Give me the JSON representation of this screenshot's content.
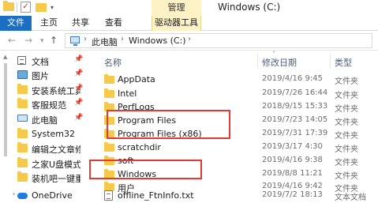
{
  "window": {
    "title": "Windows (C:)",
    "context_tab_group": "管理"
  },
  "quick_access": {
    "dropdown_glyph": "▾"
  },
  "ribbon": {
    "tabs": [
      {
        "label": "文件"
      },
      {
        "label": "主页"
      },
      {
        "label": "共享"
      },
      {
        "label": "查看"
      },
      {
        "label": "驱动器工具"
      }
    ]
  },
  "address": {
    "crumbs": [
      "此电脑",
      "Windows (C:)"
    ]
  },
  "nav_pane": {
    "items": [
      {
        "label": "文档",
        "icon": "document-icon",
        "pinned": true
      },
      {
        "label": "图片",
        "icon": "picture-icon",
        "pinned": true
      },
      {
        "label": "安装系统工具",
        "icon": "folder-icon",
        "pinned": true
      },
      {
        "label": "客服规范",
        "icon": "folder-icon",
        "pinned": true
      },
      {
        "label": "此电脑",
        "icon": "computer-icon",
        "pinned": true
      },
      {
        "label": "System32",
        "icon": "folder-icon",
        "pinned": false
      },
      {
        "label": "编辑之文章修改",
        "icon": "folder-icon",
        "pinned": false
      },
      {
        "label": "之家U盘模式装系",
        "icon": "folder-icon",
        "pinned": false
      },
      {
        "label": "装机吧一键重装",
        "icon": "folder-icon",
        "pinned": false
      },
      {
        "label": "OneDrive",
        "icon": "onedrive-cloud-icon",
        "pinned": false
      }
    ],
    "pin_glyph": "📌"
  },
  "file_list": {
    "columns": {
      "name": "名称",
      "date": "修改日期",
      "type": "类型"
    },
    "rows": [
      {
        "name": "AppData",
        "date": "2019/4/16 9:45",
        "type": "文件夹",
        "kind": "folder"
      },
      {
        "name": "Intel",
        "date": "2019/7/26 16:44",
        "type": "文件夹",
        "kind": "folder"
      },
      {
        "name": "PerfLogs",
        "date": "2018/9/15 15:33",
        "type": "文件夹",
        "kind": "folder"
      },
      {
        "name": "Program Files",
        "date": "2019/7/23 14:05",
        "type": "文件夹",
        "kind": "folder"
      },
      {
        "name": "Program Files (x86)",
        "date": "2019/7/31 17:39",
        "type": "文件夹",
        "kind": "folder"
      },
      {
        "name": "scratchdir",
        "date": "2019/3/17 4:30",
        "type": "文件夹",
        "kind": "folder"
      },
      {
        "name": "soft",
        "date": "2019/4/16 9:38",
        "type": "文件夹",
        "kind": "folder"
      },
      {
        "name": "Windows",
        "date": "2019/8/8 11:21",
        "type": "文件夹",
        "kind": "folder"
      },
      {
        "name": "用户",
        "date": "2019/4/16 9:42",
        "type": "文件夹",
        "kind": "folder"
      },
      {
        "name": "offline_FtnInfo.txt",
        "date": "2019/7/2 18:13",
        "type": "文本文档",
        "kind": "text"
      }
    ]
  },
  "colors": {
    "file_tab_bg": "#1b6ec2",
    "context_tab_bg": "#fdf1c6",
    "folder_icon": "#f5c94b",
    "highlight_box": "#e53935",
    "column_header_text": "#4c607a"
  }
}
